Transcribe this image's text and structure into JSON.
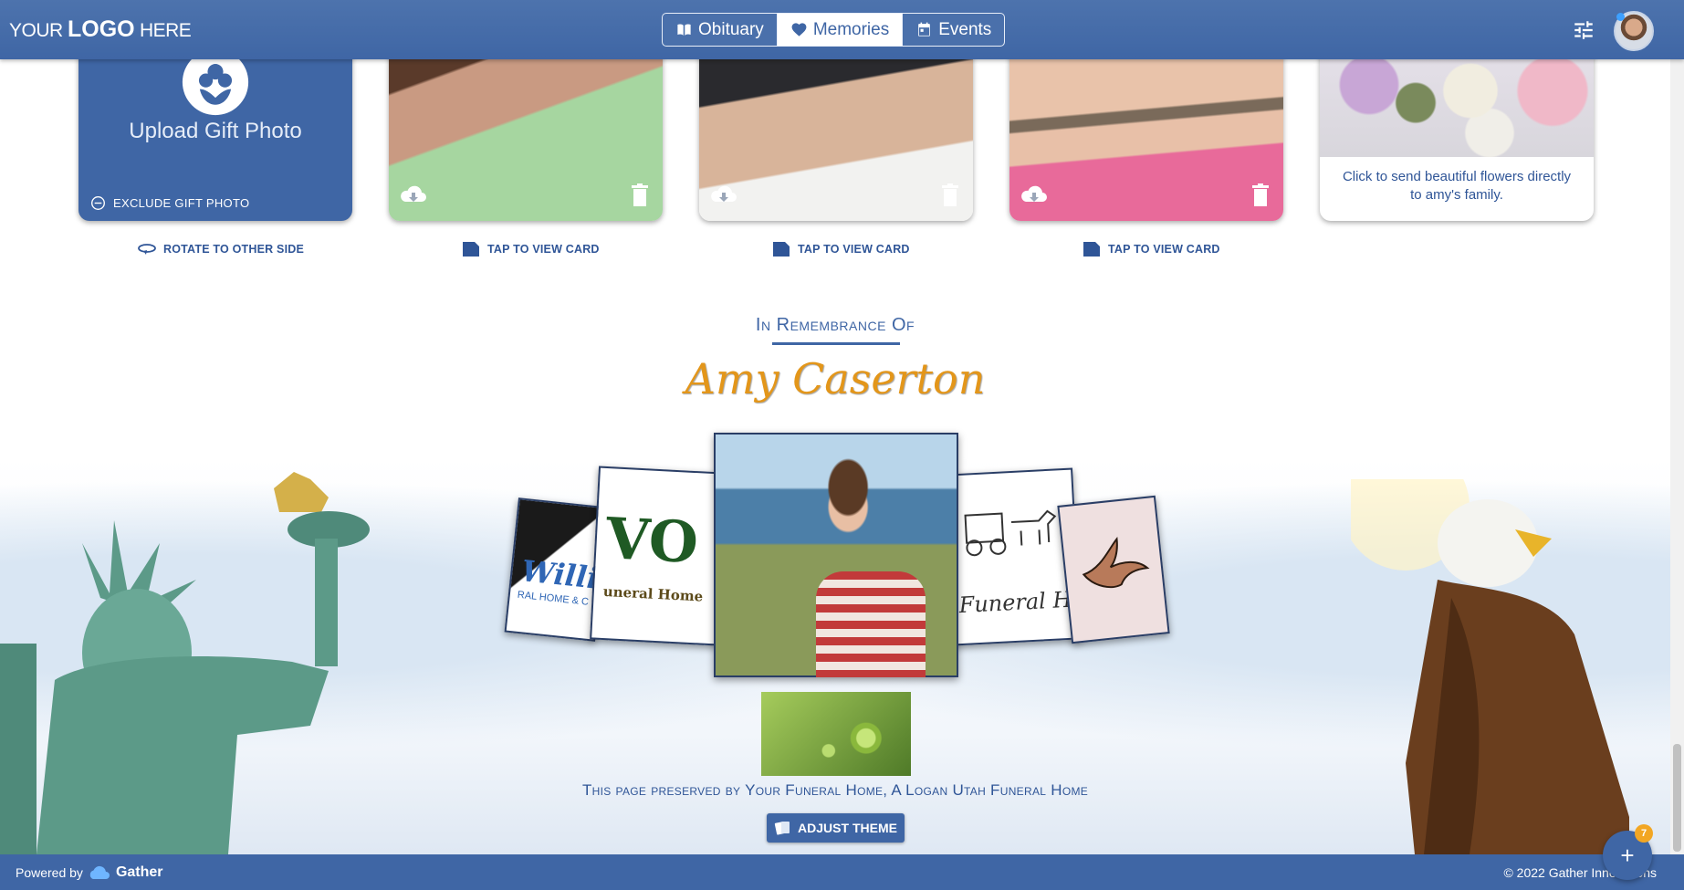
{
  "header": {
    "logo": {
      "your": "YOUR ",
      "logo": "LOGO",
      "here": " HERE"
    },
    "tabs": [
      {
        "label": "Obituary",
        "icon": "book-icon"
      },
      {
        "label": "Memories",
        "icon": "heart-icon",
        "active": true
      },
      {
        "label": "Events",
        "icon": "calendar-icon"
      }
    ],
    "notification_dot_color": "#3da0ff"
  },
  "cards": {
    "upload": {
      "label": "Upload Gift Photo",
      "exclude_label": "EXCLUDE GIFT PHOTO",
      "action": "ROTATE TO OTHER SIDE"
    },
    "photo_actions": [
      "TAP TO VIEW CARD",
      "TAP TO VIEW CARD",
      "TAP TO VIEW CARD"
    ],
    "flowers": {
      "text": "Click to send beautiful flowers directly to amy's family."
    }
  },
  "remembrance": {
    "title": "In Remembrance Of",
    "name": "Amy Caserton"
  },
  "carousel": {
    "logo1_mark": "Willia",
    "logo1_sub": "RAL HOME & C",
    "logo2_mark": "VO",
    "logo2_sub": "uneral Home",
    "logo4_sub": "Funeral H"
  },
  "preserved_text": "This page preserved by Your Funeral Home, A Logan Utah Funeral Home",
  "adjust_theme_label": "ADJUST THEME",
  "footer": {
    "powered_by": "Powered by",
    "brand": "Gather",
    "copyright": "© 2022 Gather Innovations"
  },
  "fab": {
    "label": "+",
    "badge_count": "7"
  },
  "colors": {
    "primary": "#3f66a5",
    "accent_name": "#e3961a",
    "badge": "#f2a623"
  }
}
